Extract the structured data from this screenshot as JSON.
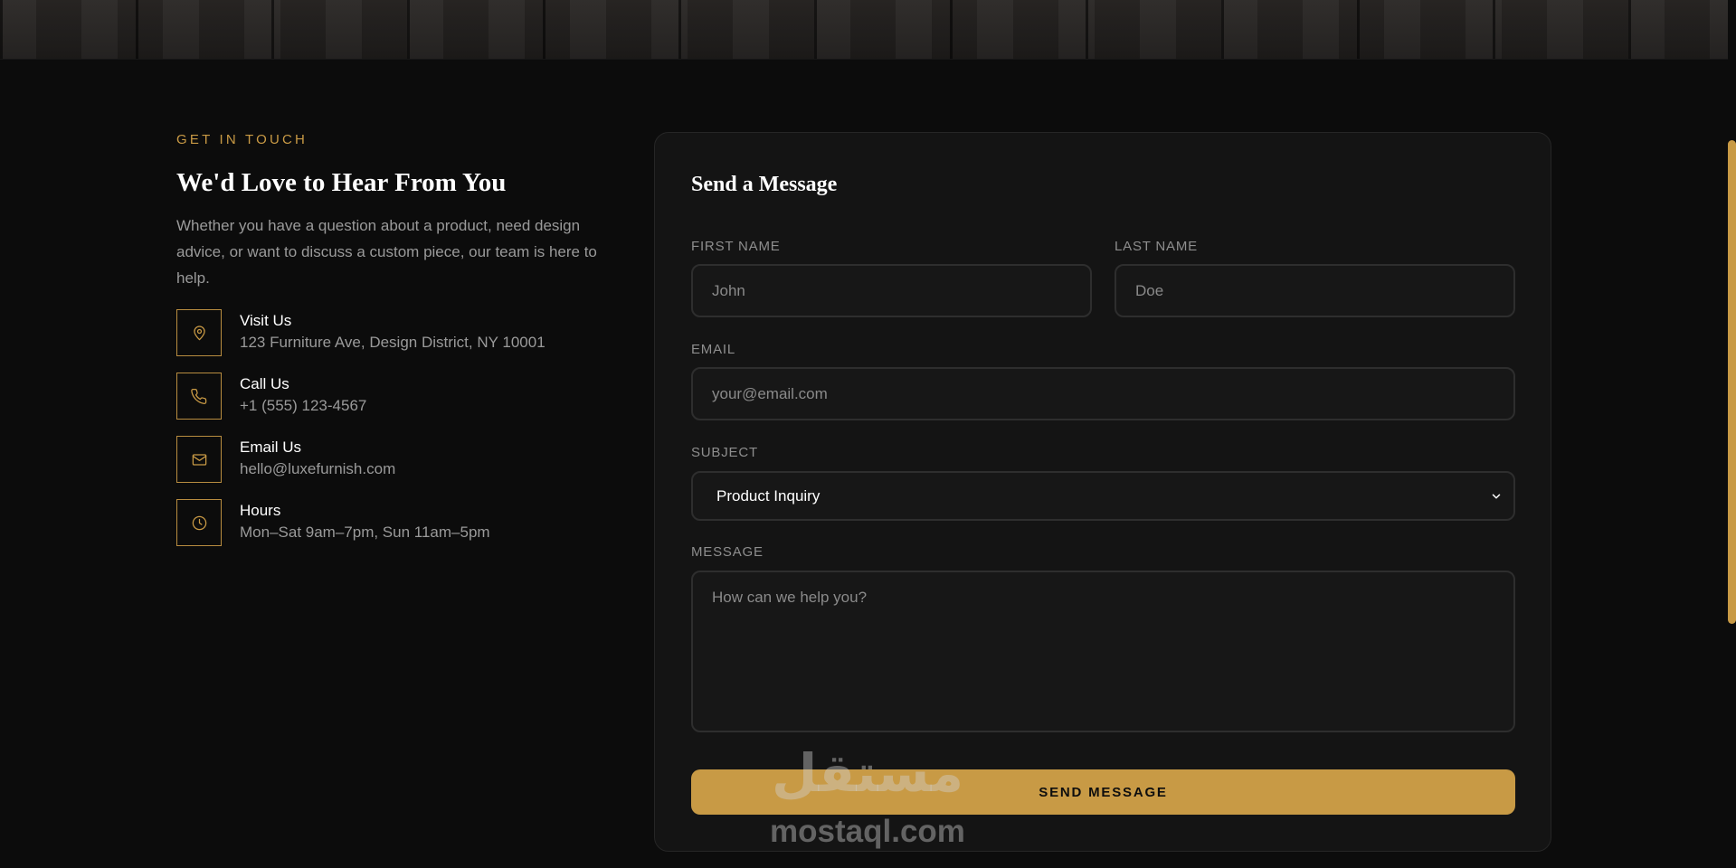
{
  "contact": {
    "eyebrow": "GET IN TOUCH",
    "heading": "We'd Love to Hear From You",
    "intro": "Whether you have a question about a product, need design advice, or want to discuss a custom piece, our team is here to help.",
    "items": [
      {
        "icon": "location-pin-icon",
        "title": "Visit Us",
        "value": "123 Furniture Ave, Design District, NY 10001"
      },
      {
        "icon": "phone-icon",
        "title": "Call Us",
        "value": "+1 (555) 123-4567"
      },
      {
        "icon": "mail-icon",
        "title": "Email Us",
        "value": "hello@luxefurnish.com"
      },
      {
        "icon": "clock-icon",
        "title": "Hours",
        "value": "Mon–Sat 9am–7pm, Sun 11am–5pm"
      }
    ]
  },
  "form": {
    "title": "Send a Message",
    "first_name": {
      "label": "FIRST NAME",
      "placeholder": "John"
    },
    "last_name": {
      "label": "LAST NAME",
      "placeholder": "Doe"
    },
    "email": {
      "label": "EMAIL",
      "placeholder": "your@email.com"
    },
    "subject": {
      "label": "SUBJECT",
      "value": "Product Inquiry"
    },
    "message": {
      "label": "MESSAGE",
      "placeholder": "How can we help you?"
    },
    "submit_label": "SEND MESSAGE"
  },
  "watermark": {
    "logo": "مستقل",
    "url": "mostaql.com"
  },
  "colors": {
    "accent": "#c89a45",
    "background": "#0c0c0c",
    "card": "#141414",
    "muted_text": "#9a9a9a"
  }
}
